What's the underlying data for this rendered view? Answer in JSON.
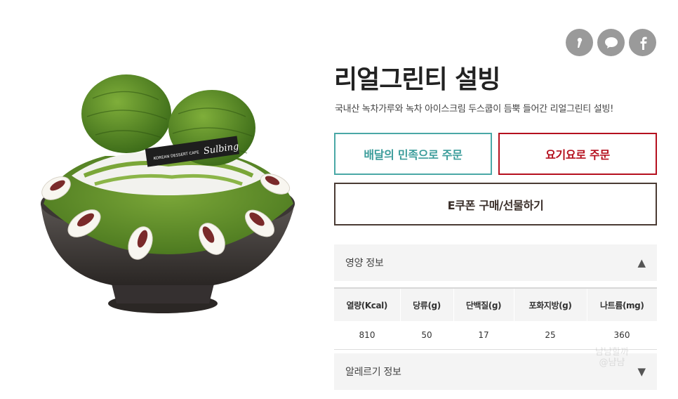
{
  "share": {
    "icons": [
      "kakaostory-icon",
      "kakaotalk-icon",
      "facebook-icon"
    ],
    "color": "#9a9a9a"
  },
  "product": {
    "image_icon": "green-tea-bingsu-illustration",
    "brand_plaque": "Sulbing",
    "brand_plaque_small": "KOREAN DESSERT CAFE",
    "title": "리얼그린티 설빙",
    "description": "국내산 녹차가루와 녹차 아이스크림 두스쿱이 듬뿍 들어간 리얼그린티 설빙!"
  },
  "order": {
    "baemin_label": "배달의 민족으로 주문",
    "yogiyo_label": "요기요로 주문",
    "ecoupon_label": "E쿠폰 구매/선물하기",
    "colors": {
      "baemin": "#3c9d9b",
      "yogiyo": "#b5101e",
      "ecoupon": "#3a2e29"
    }
  },
  "nutrition": {
    "label": "영양 정보",
    "arrow": "▲",
    "headers": [
      "열량(Kcal)",
      "당류(g)",
      "단백질(g)",
      "포화지방(g)",
      "나트륨(mg)"
    ],
    "values": [
      "810",
      "50",
      "17",
      "25",
      "360"
    ]
  },
  "allergy": {
    "label": "알레르기 정보",
    "arrow": "▼"
  },
  "watermark": {
    "line1": "냠냠할까",
    "line2": "@냠냠"
  }
}
